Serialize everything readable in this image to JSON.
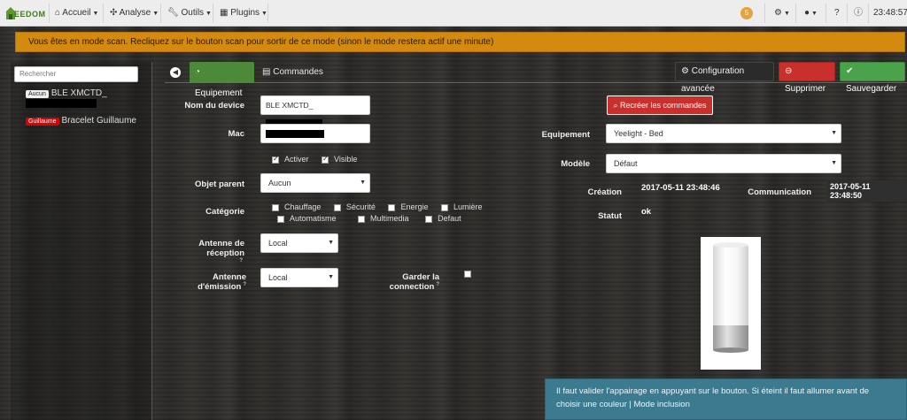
{
  "navbar": {
    "logo_text": "EEDOM",
    "menu": [
      {
        "label": "Accueil",
        "icon": "home-icon"
      },
      {
        "label": "Analyse",
        "icon": "analyse-icon"
      },
      {
        "label": "Outils",
        "icon": "wrench-icon"
      },
      {
        "label": "Plugins",
        "icon": "plugins-icon"
      }
    ],
    "notification_count": "5",
    "time": "23:48:57"
  },
  "scan_alert": "Vous êtes en mode scan. Recliquez sur le bouton scan pour sortir de ce mode (sinon le mode restera actif une minute)",
  "sidebar": {
    "search_placeholder": "Rechercher",
    "devices": [
      {
        "tag": "Aucun",
        "name": "BLE XMCTD_"
      },
      {
        "tag": "Guillaume",
        "name": "Bracelet Guillaume"
      }
    ]
  },
  "tabs": {
    "equipement": "Equipement",
    "commandes": "Commandes"
  },
  "actions": {
    "config": "Configuration avancée",
    "delete": "Supprimer",
    "save": "Sauvegarder"
  },
  "form": {
    "nom_label": "Nom du device",
    "nom_value": "BLE XMCTD_",
    "mac_label": "Mac",
    "activer": "Activer",
    "visible": "Visible",
    "objet_label": "Objet parent",
    "objet_value": "Aucun",
    "categorie_label": "Catégorie",
    "categories": [
      "Chauffage",
      "Sécurité",
      "Energie",
      "Lumière",
      "Automatisme",
      "Multimedia",
      "Defaut"
    ],
    "antenne_recep_label": "Antenne de réception",
    "antenne_recep_value": "Local",
    "antenne_emis_label": "Antenne d'émission",
    "antenne_emis_value": "Local",
    "garder_label": "Garder la connection"
  },
  "right": {
    "recreate": "Recréer les commandes",
    "equipement_label": "Equipement",
    "equipement_value": "Yeelight - Bed",
    "modele_label": "Modèle",
    "modele_value": "Défaut",
    "creation_label": "Création",
    "creation_value": "2017-05-11 23:48:46",
    "communication_label": "Communication",
    "communication_value": "2017-05-11 23:48:50",
    "statut_label": "Statut",
    "statut_value": "ok",
    "lamp_brand": "Yeelight"
  },
  "info_alert": "Il faut valider l'appairage en appuyant sur le bouton. Si éteint il faut allumer avant de choisir une couleur | Mode inclusion"
}
